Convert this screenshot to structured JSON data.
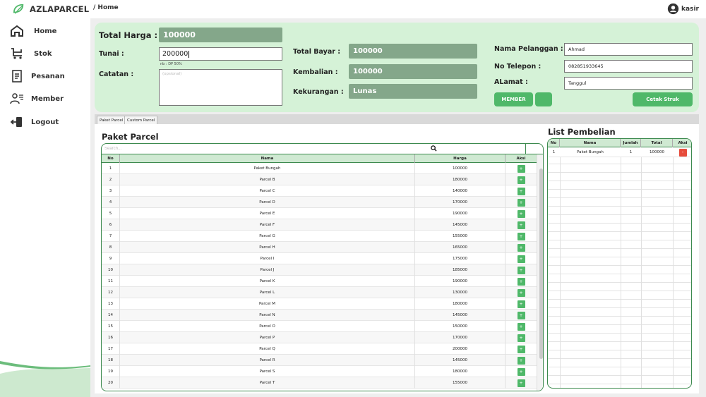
{
  "app": {
    "brand": "AZLAPARCEL"
  },
  "breadcrumb": "/ Home",
  "user": {
    "name": "kasir"
  },
  "sidebar": {
    "items": [
      {
        "label": "Home",
        "icon": "home-icon"
      },
      {
        "label": "Stok",
        "icon": "cart-icon"
      },
      {
        "label": "Pesanan",
        "icon": "document-icon"
      },
      {
        "label": "Member",
        "icon": "user-list-icon"
      },
      {
        "label": "Logout",
        "icon": "logout-icon"
      }
    ]
  },
  "form": {
    "total_harga_label": "Total Harga :",
    "total_harga_value": "100000",
    "tunai_label": "Tunai :",
    "tunai_value": "200000",
    "tunai_note": "nb : DP 50%",
    "catatan_label": "Catatan :",
    "catatan_placeholder": "(opsional)",
    "total_bayar_label": "Total Bayar :",
    "total_bayar_value": "100000",
    "kembalian_label": "Kembalian :",
    "kembalian_value": "100000",
    "kekurangan_label": "Kekurangan :",
    "kekurangan_value": "Lunas",
    "nama_label": "Nama Pelanggan :",
    "nama_value": "Ahmad",
    "telepon_label": "No Telepon :",
    "telepon_value": "082851933645",
    "alamat_label": "ALamat :",
    "alamat_value": "Tanggul",
    "member_button": "MEMBER",
    "cetak_button": "Cetak Struk"
  },
  "tabs": [
    "Paket Parcel",
    "Custom Parcel"
  ],
  "paket": {
    "title": "Paket Parcel",
    "search_placeholder": "Search...",
    "columns": [
      "No",
      "Nama",
      "Harga",
      "Aksi"
    ],
    "add_label": "+",
    "rows": [
      {
        "no": "1",
        "nama": "Paket Bungah",
        "harga": "100000"
      },
      {
        "no": "2",
        "nama": "Parcel B",
        "harga": "180000"
      },
      {
        "no": "3",
        "nama": "Parcel C",
        "harga": "140000"
      },
      {
        "no": "4",
        "nama": "Parcel D",
        "harga": "170000"
      },
      {
        "no": "5",
        "nama": "Parcel E",
        "harga": "190000"
      },
      {
        "no": "6",
        "nama": "Parcel F",
        "harga": "145000"
      },
      {
        "no": "7",
        "nama": "Parcel G",
        "harga": "155000"
      },
      {
        "no": "8",
        "nama": "Parcel H",
        "harga": "165000"
      },
      {
        "no": "9",
        "nama": "Parcel I",
        "harga": "175000"
      },
      {
        "no": "10",
        "nama": "Parcel J",
        "harga": "185000"
      },
      {
        "no": "11",
        "nama": "Parcel K",
        "harga": "190000"
      },
      {
        "no": "12",
        "nama": "Parcel L",
        "harga": "130000"
      },
      {
        "no": "13",
        "nama": "Parcel M",
        "harga": "180000"
      },
      {
        "no": "14",
        "nama": "Parcel N",
        "harga": "145000"
      },
      {
        "no": "15",
        "nama": "Parcel O",
        "harga": "150000"
      },
      {
        "no": "16",
        "nama": "Parcel P",
        "harga": "170000"
      },
      {
        "no": "17",
        "nama": "Parcel Q",
        "harga": "200000"
      },
      {
        "no": "18",
        "nama": "Parcel R",
        "harga": "145000"
      },
      {
        "no": "19",
        "nama": "Parcel S",
        "harga": "180000"
      },
      {
        "no": "20",
        "nama": "Parcel T",
        "harga": "155000"
      }
    ]
  },
  "pembelian": {
    "title": "List Pembelian",
    "columns": [
      "No",
      "Nama",
      "Jumlah",
      "Total",
      "Aksi"
    ],
    "delete_label": "-",
    "rows": [
      {
        "no": "1",
        "nama": "Paket Bungah",
        "jumlah": "1",
        "total": "100000"
      }
    ]
  },
  "colors": {
    "accent": "#4fb869",
    "panel": "#d5f2d7",
    "readonly": "#84a78a",
    "danger": "#e74c3c"
  }
}
